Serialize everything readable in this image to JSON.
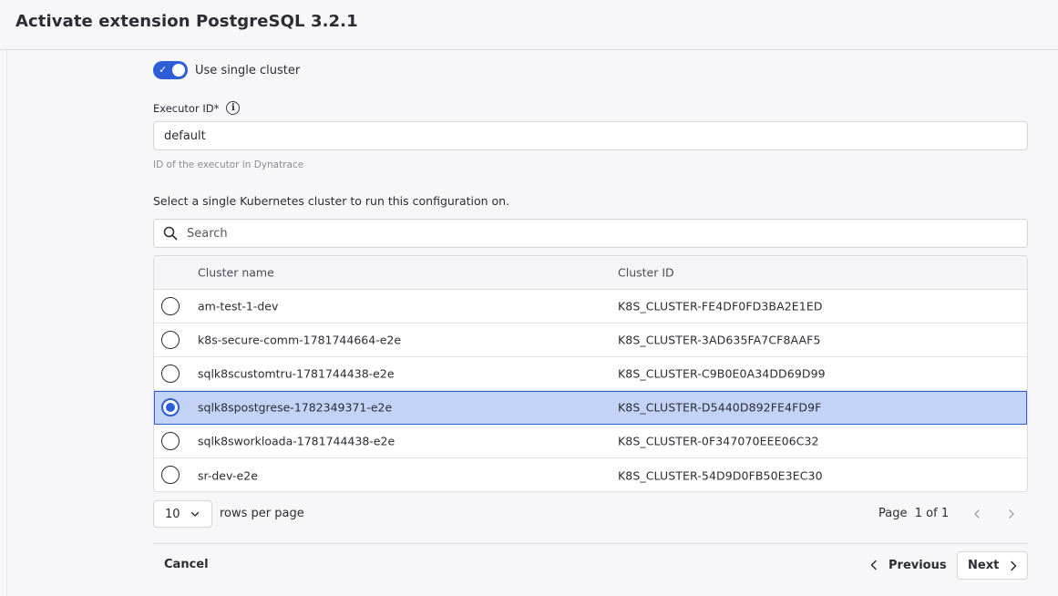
{
  "dialog": {
    "title": "Activate extension PostgreSQL 3.2.1"
  },
  "toggle": {
    "label": "Use single cluster",
    "checked": true
  },
  "executor": {
    "label": "Executor ID*",
    "value": "default",
    "hint": "ID of the executor in Dynatrace"
  },
  "cluster_select": {
    "instruction": "Select a single Kubernetes cluster to run this configuration on.",
    "search_placeholder": "Search",
    "columns": [
      "Cluster name",
      "Cluster ID"
    ],
    "rows": [
      {
        "name": "am-test-1-dev",
        "id": "K8S_CLUSTER-FE4DF0FD3BA2E1ED",
        "selected": false
      },
      {
        "name": "k8s-secure-comm-1781744664-e2e",
        "id": "K8S_CLUSTER-3AD635FA7CF8AAF5",
        "selected": false
      },
      {
        "name": "sqlk8scustomtru-1781744438-e2e",
        "id": "K8S_CLUSTER-C9B0E0A34DD69D99",
        "selected": false
      },
      {
        "name": "sqlk8spostgrese-1782349371-e2e",
        "id": "K8S_CLUSTER-D5440D892FE4FD9F",
        "selected": true
      },
      {
        "name": "sqlk8sworkloada-1781744438-e2e",
        "id": "K8S_CLUSTER-0F347070EEE06C32",
        "selected": false
      },
      {
        "name": "sr-dev-e2e",
        "id": "K8S_CLUSTER-54D9D0FB50E3EC30",
        "selected": false
      }
    ]
  },
  "pagination": {
    "rows_per_page_value": "10",
    "rows_per_page_label": "rows per page",
    "page_label": "Page",
    "page_value": "1 of 1"
  },
  "footer": {
    "cancel_label": "Cancel",
    "previous_label": "Previous",
    "next_label": "Next"
  },
  "colors": {
    "accent": "#2d5ed8",
    "selected_row": "#c3d3f7"
  }
}
